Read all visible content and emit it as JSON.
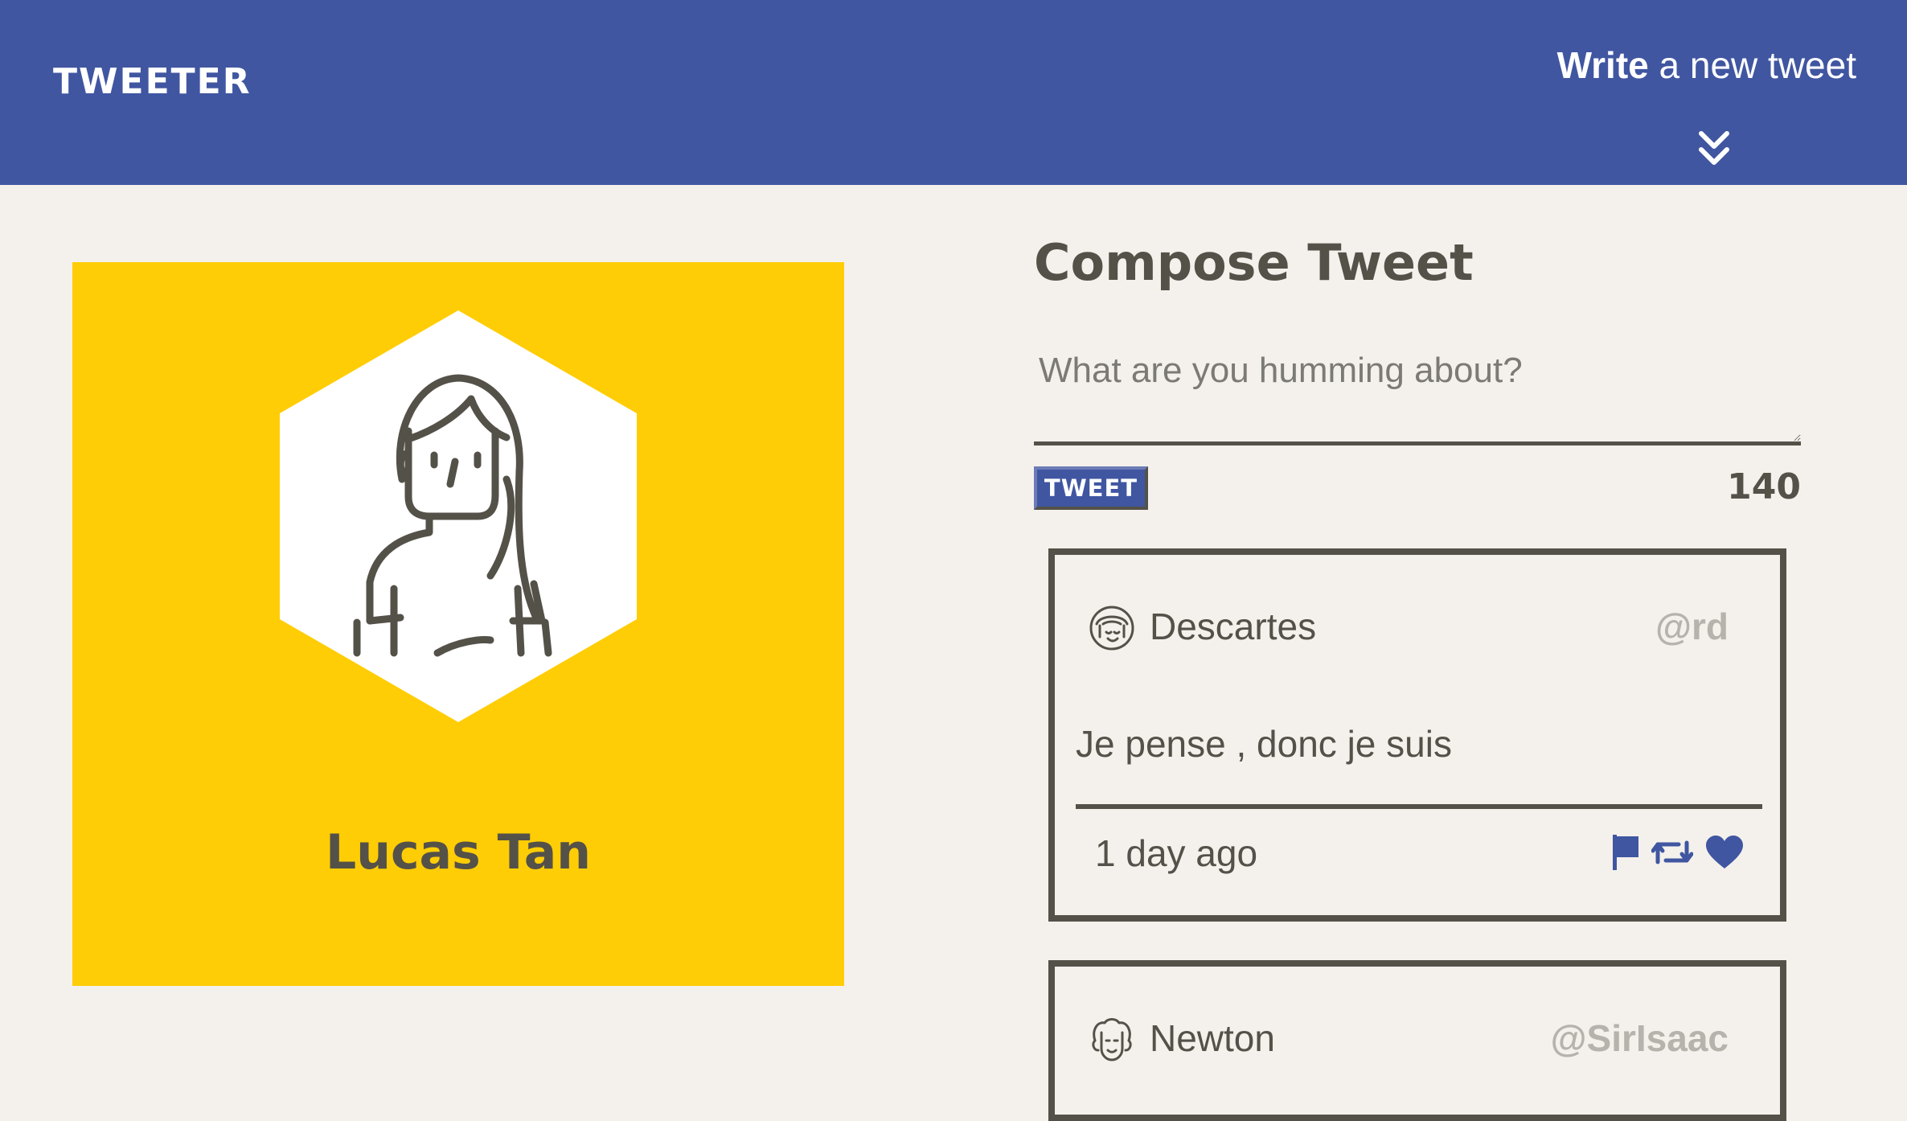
{
  "nav": {
    "brand": "TWEETER",
    "write_strong": "Write",
    "write_rest": "a new tweet",
    "toggle_icon": "double-chevron-down-icon"
  },
  "profile": {
    "name": "Lucas Tan",
    "background_color": "#ffcd05",
    "avatar_icon": "woman-avatar-icon"
  },
  "compose": {
    "title": "Compose Tweet",
    "placeholder": "What are you humming about?",
    "value": "",
    "button_label": "TWEET",
    "char_count": "140"
  },
  "tweets": [
    {
      "name": "Descartes",
      "handle": "@rd",
      "avatar_icon": "descartes-avatar-icon",
      "text": "Je pense , donc je suis",
      "time": "1 day ago",
      "actions": [
        "flag-icon",
        "retweet-icon",
        "heart-icon"
      ]
    },
    {
      "name": "Newton",
      "handle": "@SirIsaac",
      "avatar_icon": "newton-avatar-icon"
    }
  ],
  "colors": {
    "primary": "#4056a1",
    "accent": "#ffcd05",
    "text": "#545149",
    "background": "#f4f1ec",
    "muted": "#b6b3ad"
  }
}
